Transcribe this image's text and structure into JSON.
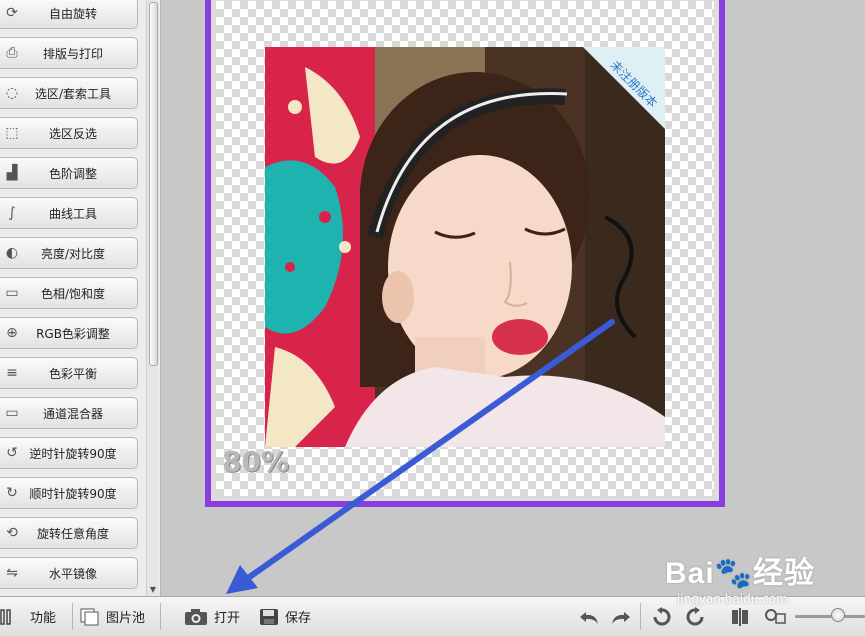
{
  "tools": [
    {
      "label": "自由旋转",
      "icon": "rotate-icon"
    },
    {
      "label": "排版与打印",
      "icon": "printer-icon"
    },
    {
      "label": "选区/套索工具",
      "icon": "lasso-icon"
    },
    {
      "label": "选区反选",
      "icon": "invert-selection-icon"
    },
    {
      "label": "色阶调整",
      "icon": "levels-icon"
    },
    {
      "label": "曲线工具",
      "icon": "curves-icon"
    },
    {
      "label": "亮度/对比度",
      "icon": "contrast-icon"
    },
    {
      "label": "色相/饱和度",
      "icon": "hue-saturation-icon"
    },
    {
      "label": "RGB色彩调整",
      "icon": "rgb-circles-icon"
    },
    {
      "label": "色彩平衡",
      "icon": "balance-sliders-icon"
    },
    {
      "label": "通道混合器",
      "icon": "channel-mixer-icon"
    },
    {
      "label": "逆时针旋转90度",
      "icon": "rotate-ccw-90-icon"
    },
    {
      "label": "顺时针旋转90度",
      "icon": "rotate-cw-90-icon"
    },
    {
      "label": "旋转任意角度",
      "icon": "rotate-any-icon"
    },
    {
      "label": "水平镜像",
      "icon": "mirror-icon"
    }
  ],
  "canvas": {
    "zoom": "80%",
    "corner_ribbon": "未注册版本",
    "frame_color": "#8a3ee0"
  },
  "toolbar": {
    "function_label": "功能",
    "pictures_label": "图片池",
    "open_label": "打开",
    "save_label": "保存",
    "icons": [
      "undo-icon",
      "redo-icon",
      "rotate-left-icon",
      "rotate-right-icon",
      "compare-icon",
      "zoom-icon"
    ]
  },
  "watermark": {
    "logo": "Bai🐾经验",
    "url": "jingyan.baidu.com"
  },
  "annotation": {
    "arrow_color": "#3b5bd6"
  }
}
